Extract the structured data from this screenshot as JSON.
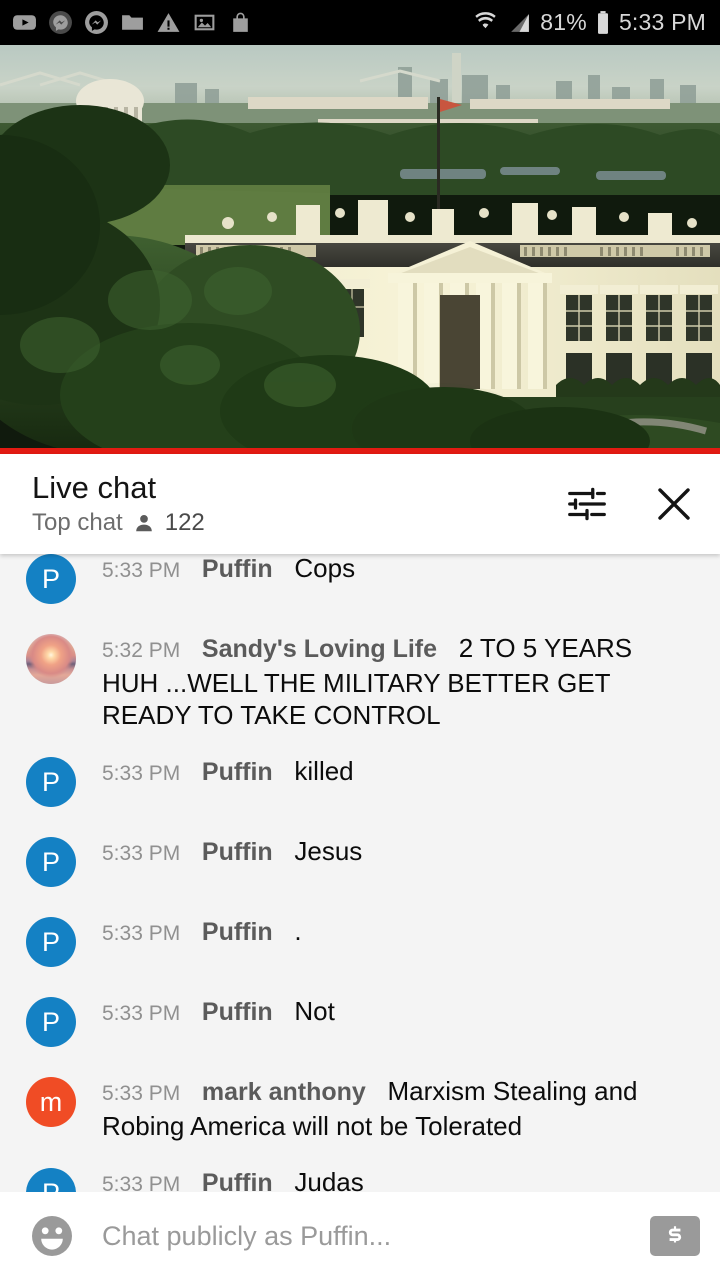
{
  "status_bar": {
    "icons": [
      "youtube-icon",
      "messenger-muted-icon",
      "messenger-icon",
      "folder-icon",
      "warning-icon",
      "image-icon",
      "shopping-bag-icon"
    ],
    "wifi_icon": "wifi-icon",
    "signal_icon": "cell-signal-icon",
    "battery_percent": "81%",
    "battery_icon": "battery-icon",
    "clock": "5:33 PM"
  },
  "video": {
    "name": "white-house-live-stream",
    "progress_percent": 100,
    "progress_color": "#e21b12"
  },
  "chat_header": {
    "title": "Live chat",
    "mode": "Top chat",
    "viewer_count": "122",
    "person_icon": "person-icon",
    "settings_icon": "chat-settings-icon",
    "close_icon": "close-icon"
  },
  "messages": [
    {
      "time": "5:33 PM",
      "author": "Puffin",
      "text": "Cops",
      "avatar_type": "initial",
      "avatar_initial": "P",
      "avatar_color": "#1481c4",
      "clipped": "top"
    },
    {
      "time": "5:32 PM",
      "author": "Sandy's Loving Life",
      "text": "2 TO 5 YEARS HUH ...WELL THE MILITARY BETTER GET READY TO TAKE CONTROL",
      "avatar_type": "photo",
      "avatar_initial": "",
      "avatar_color": "#d98f87",
      "clipped": "none"
    },
    {
      "time": "5:33 PM",
      "author": "Puffin",
      "text": "killed",
      "avatar_type": "initial",
      "avatar_initial": "P",
      "avatar_color": "#1481c4",
      "clipped": "none"
    },
    {
      "time": "5:33 PM",
      "author": "Puffin",
      "text": "Jesus",
      "avatar_type": "initial",
      "avatar_initial": "P",
      "avatar_color": "#1481c4",
      "clipped": "none"
    },
    {
      "time": "5:33 PM",
      "author": "Puffin",
      "text": ".",
      "avatar_type": "initial",
      "avatar_initial": "P",
      "avatar_color": "#1481c4",
      "clipped": "none"
    },
    {
      "time": "5:33 PM",
      "author": "Puffin",
      "text": "Not",
      "avatar_type": "initial",
      "avatar_initial": "P",
      "avatar_color": "#1481c4",
      "clipped": "none"
    },
    {
      "time": "5:33 PM",
      "author": "mark anthony",
      "text": "Marxism Stealing and Robing America will not be Tolerated",
      "avatar_type": "initial",
      "avatar_initial": "m",
      "avatar_color": "#f04c25",
      "clipped": "none"
    },
    {
      "time": "5:33 PM",
      "author": "Puffin",
      "text": "Judas",
      "avatar_type": "initial",
      "avatar_initial": "P",
      "avatar_color": "#1481c4",
      "clipped": "bottom"
    }
  ],
  "composer": {
    "emoji_icon": "emoji-smiley-icon",
    "placeholder": "Chat publicly as Puffin...",
    "value": "",
    "super_chat_icon": "super-chat-dollar-icon"
  }
}
